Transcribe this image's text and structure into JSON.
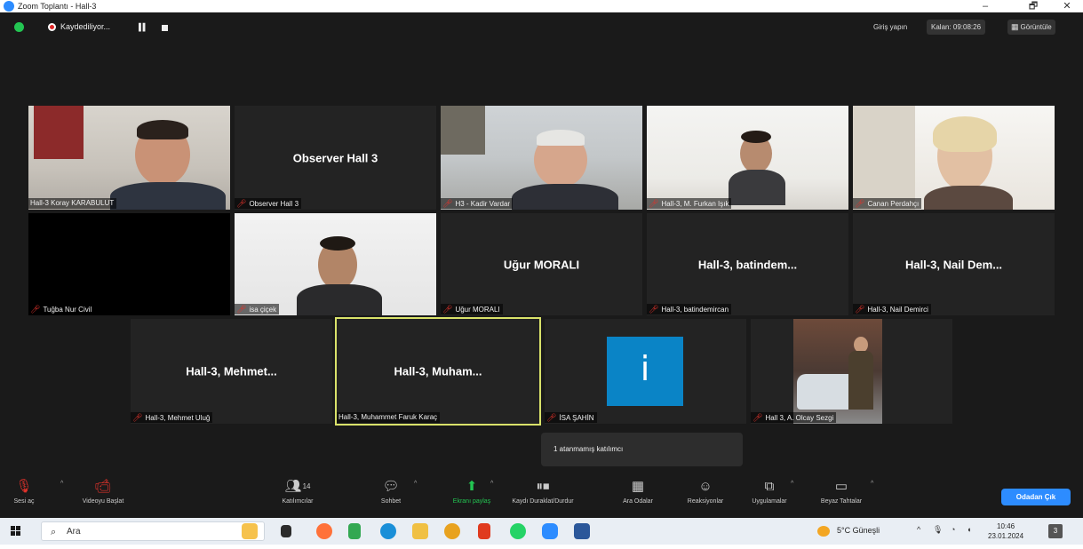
{
  "window": {
    "title": "Zoom Toplantı - Hall-3",
    "minimize": "–",
    "restore": "🗗",
    "close": "✕"
  },
  "topbar": {
    "recording_label": "Kaydediliyor...",
    "sign_in": "Giriş yapın",
    "timer": "Kalan: 09:08:26",
    "view_label": "Görüntüle",
    "view_icon": "▦"
  },
  "participants": [
    {
      "name": "Hall-3 Koray KARABULUT",
      "muted": false,
      "video": true,
      "big_label": ""
    },
    {
      "name": "Observer Hall 3",
      "muted": true,
      "video": false,
      "big_label": "Observer Hall 3"
    },
    {
      "name": "H3 - Kadir Vardar",
      "muted": true,
      "video": true,
      "big_label": ""
    },
    {
      "name": "Hall-3, M. Furkan Işık",
      "muted": true,
      "video": true,
      "big_label": ""
    },
    {
      "name": "Canan Perdahçı",
      "muted": true,
      "video": true,
      "big_label": ""
    },
    {
      "name": "Tuğba Nur Civil",
      "muted": true,
      "video": false,
      "big_label": ""
    },
    {
      "name": "isa çiçek",
      "muted": true,
      "video": true,
      "big_label": ""
    },
    {
      "name": "Uğur MORALI",
      "muted": true,
      "video": false,
      "big_label": "Uğur MORALI"
    },
    {
      "name": "Hall-3, batindemircan",
      "muted": true,
      "video": false,
      "big_label": "Hall-3, batindem..."
    },
    {
      "name": "Hall-3, Nail Demirci",
      "muted": true,
      "video": false,
      "big_label": "Hall-3, Nail Dem..."
    },
    {
      "name": "Hall-3, Mehmet Uluğ",
      "muted": true,
      "video": false,
      "big_label": "Hall-3, Mehmet..."
    },
    {
      "name": "Hall-3, Muhammet Faruk Karaç",
      "muted": false,
      "video": false,
      "big_label": "Hall-3, Muham...",
      "active_speaker": true
    },
    {
      "name": "İSA ŞAHİN",
      "muted": true,
      "video": false,
      "big_label": "i"
    },
    {
      "name": "Hall 3, A. Olcay Sezgi",
      "muted": true,
      "video": true,
      "big_label": ""
    }
  ],
  "tooltip": "1 atanmamış katılımcı",
  "toolbar": {
    "audio": "Sesi aç",
    "video": "Videoyu Başlat",
    "participants": "Katılımcılar",
    "participants_count": "14",
    "chat": "Sohbet",
    "share": "Ekranı paylaş",
    "record": "Kaydı Duraklat/Durdur",
    "breakout": "Ara Odalar",
    "reactions": "Reaksiyonlar",
    "apps": "Uygulamalar",
    "whiteboards": "Beyaz Tahtalar",
    "leave": "Odadan Çık"
  },
  "taskbar": {
    "search_placeholder": "Ara",
    "weather": "5°C Güneşli",
    "time": "10:46",
    "date": "23.01.2024",
    "notification_count": "3"
  },
  "colors": {
    "zoom_blue": "#2d8cff",
    "active_speaker_border": "#d9e26a",
    "muted_red": "#e0322b",
    "share_green": "#23c552"
  }
}
